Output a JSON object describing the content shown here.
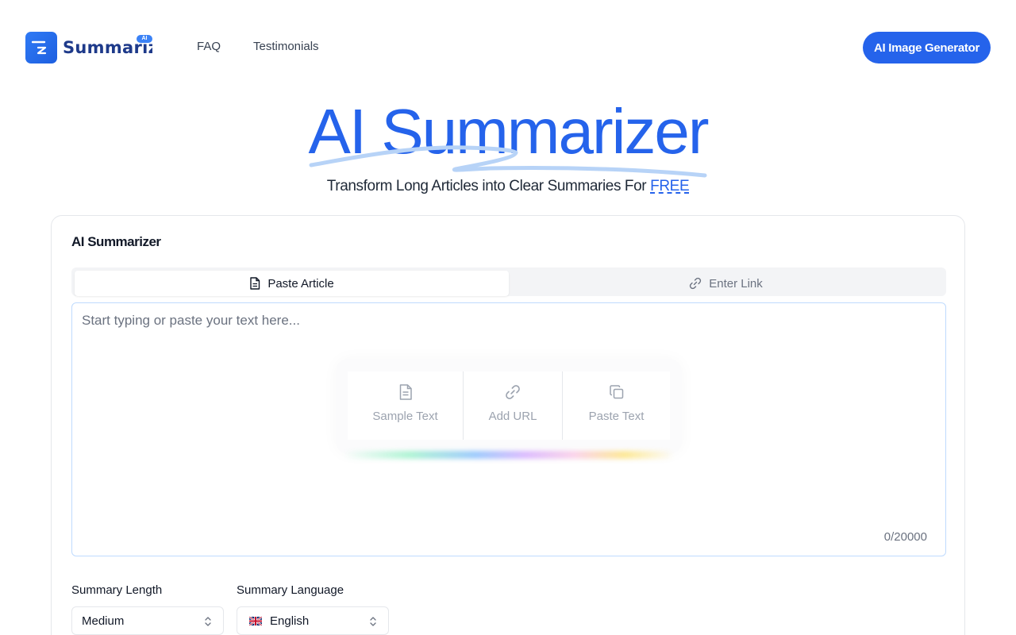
{
  "header": {
    "logo_text": "Summarizer",
    "logo_badge": "AI",
    "nav": [
      {
        "label": "FAQ"
      },
      {
        "label": "Testimonials"
      }
    ],
    "cta_label": "AI Image Generator"
  },
  "hero": {
    "title": "AI Summarizer",
    "subtitle": "Transform Long Articles into Clear Summaries For",
    "subtitle_highlight": "FREE"
  },
  "card": {
    "title": "AI Summarizer",
    "tabs": [
      {
        "label": "Paste Article",
        "icon": "document-icon",
        "active": true
      },
      {
        "label": "Enter Link",
        "icon": "link-icon",
        "active": false
      }
    ],
    "textarea": {
      "placeholder": "Start typing or paste your text here...",
      "value": "",
      "counter": "0/20000"
    },
    "quick_actions": [
      {
        "label": "Sample Text",
        "icon": "document-icon"
      },
      {
        "label": "Add URL",
        "icon": "link-icon"
      },
      {
        "label": "Paste Text",
        "icon": "copy-icon"
      }
    ],
    "summary_length": {
      "label": "Summary Length",
      "value": "Medium"
    },
    "summary_language": {
      "label": "Summary Language",
      "value": "English",
      "flag": "uk-flag-icon"
    }
  },
  "colors": {
    "accent": "#2563eb",
    "logo_text": "#1e3a8a",
    "muted": "#6b7280",
    "border": "#e5e7eb"
  }
}
